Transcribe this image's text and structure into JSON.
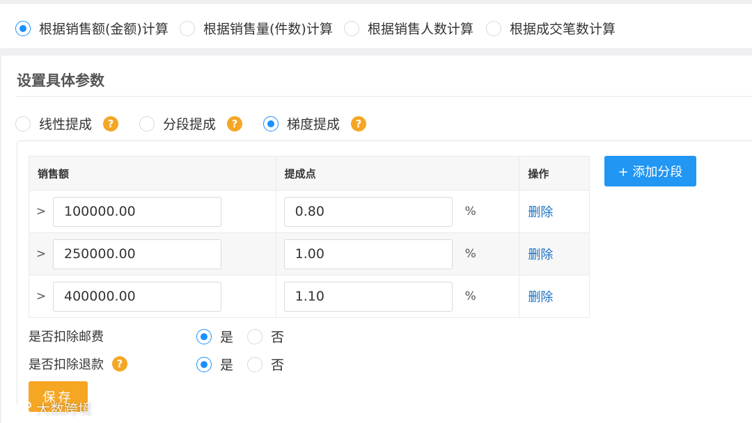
{
  "calc_basis": {
    "options": [
      {
        "label": "根据销售额(金额)计算",
        "selected": true
      },
      {
        "label": "根据销售量(件数)计算",
        "selected": false
      },
      {
        "label": "根据销售人数计算",
        "selected": false
      },
      {
        "label": "根据成交笔数计算",
        "selected": false
      }
    ]
  },
  "params": {
    "title": "设置具体参数",
    "commission_types": [
      {
        "label": "线性提成",
        "selected": false
      },
      {
        "label": "分段提成",
        "selected": false
      },
      {
        "label": "梯度提成",
        "selected": true
      }
    ],
    "help_glyph": "?"
  },
  "tiers": {
    "headers": {
      "sales": "销售额",
      "rate": "提成点",
      "action": "操作"
    },
    "prefix": ">",
    "unit": "%",
    "delete_label": "删除",
    "rows": [
      {
        "sales": "100000.00",
        "rate": "0.80"
      },
      {
        "sales": "250000.00",
        "rate": "1.00"
      },
      {
        "sales": "400000.00",
        "rate": "1.10"
      }
    ],
    "add_button": "+ 添加分段"
  },
  "deductions": {
    "shipping": {
      "label": "是否扣除邮费",
      "yes": "是",
      "no": "否",
      "value": "yes"
    },
    "refund": {
      "label": "是否扣除退款",
      "yes": "是",
      "no": "否",
      "value": "yes"
    }
  },
  "save_label": "保存",
  "watermark": "大数跨境",
  "colors": {
    "accent": "#1890ff",
    "primary_button": "#2196f3",
    "warning": "#f5a623",
    "link": "#1a73c8"
  }
}
